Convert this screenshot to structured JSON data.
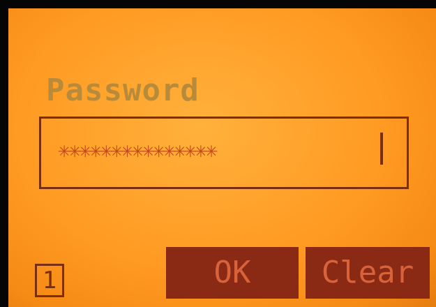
{
  "screen": {
    "label": "Password",
    "password_mask": "✳✳✳✳✳✳✳✳✳✳✳✳✳✳✳",
    "input_mode_indicator": "1",
    "softkeys": {
      "ok_label": "OK",
      "clear_label": "Clear"
    }
  },
  "colors": {
    "screen_background": "#ff9a22",
    "label_text": "#b58a3c",
    "softkey_background": "#8a2a14",
    "softkey_text": "#d8633a",
    "border": "#7a2e10"
  }
}
